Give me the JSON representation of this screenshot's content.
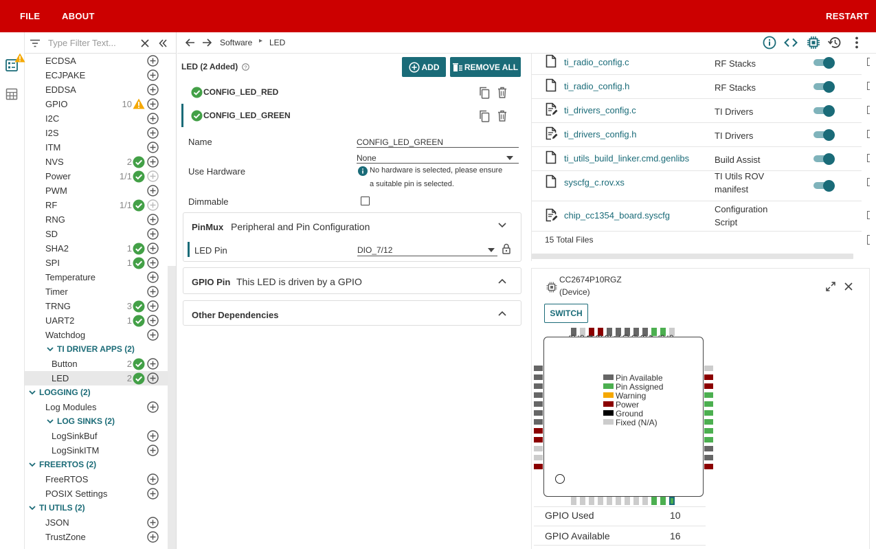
{
  "header": {
    "file": "FILE",
    "about": "ABOUT",
    "restart": "RESTART"
  },
  "filter": {
    "placeholder": "Type Filter Text..."
  },
  "tree": [
    {
      "label": "ECDSA",
      "indent": 1,
      "count": "",
      "status": "none"
    },
    {
      "label": "ECJPAKE",
      "indent": 1,
      "count": "",
      "status": "none"
    },
    {
      "label": "EDDSA",
      "indent": 1,
      "count": "",
      "status": "none"
    },
    {
      "label": "GPIO",
      "indent": 1,
      "count": "10",
      "status": "warn"
    },
    {
      "label": "I2C",
      "indent": 1,
      "count": "",
      "status": "none"
    },
    {
      "label": "I2S",
      "indent": 1,
      "count": "",
      "status": "none"
    },
    {
      "label": "ITM",
      "indent": 1,
      "count": "",
      "status": "none"
    },
    {
      "label": "NVS",
      "indent": 1,
      "count": "2",
      "status": "ok"
    },
    {
      "label": "Power",
      "indent": 1,
      "count": "1/1",
      "status": "ok",
      "disabled": true
    },
    {
      "label": "PWM",
      "indent": 1,
      "count": "",
      "status": "none"
    },
    {
      "label": "RF",
      "indent": 1,
      "count": "1/1",
      "status": "ok",
      "disabled": true
    },
    {
      "label": "RNG",
      "indent": 1,
      "count": "",
      "status": "none"
    },
    {
      "label": "SD",
      "indent": 1,
      "count": "",
      "status": "none"
    },
    {
      "label": "SHA2",
      "indent": 1,
      "count": "1",
      "status": "ok"
    },
    {
      "label": "SPI",
      "indent": 1,
      "count": "1",
      "status": "ok"
    },
    {
      "label": "Temperature",
      "indent": 1,
      "count": "",
      "status": "none"
    },
    {
      "label": "Timer",
      "indent": 1,
      "count": "",
      "status": "none"
    },
    {
      "label": "TRNG",
      "indent": 1,
      "count": "3",
      "status": "ok"
    },
    {
      "label": "UART2",
      "indent": 1,
      "count": "1",
      "status": "ok"
    },
    {
      "label": "Watchdog",
      "indent": 1,
      "count": "",
      "status": "none"
    },
    {
      "label": "TI DRIVER APPS (2)",
      "indent": 1,
      "group": true
    },
    {
      "label": "Button",
      "indent": 2,
      "count": "2",
      "status": "ok"
    },
    {
      "label": "LED",
      "indent": 2,
      "count": "2",
      "status": "ok",
      "selected": true
    },
    {
      "label": "LOGGING (2)",
      "indent": 0,
      "group": true
    },
    {
      "label": "Log Modules",
      "indent": 1,
      "count": "",
      "status": "none"
    },
    {
      "label": "LOG SINKS (2)",
      "indent": 1,
      "group": true
    },
    {
      "label": "LogSinkBuf",
      "indent": 2,
      "count": "",
      "status": "none"
    },
    {
      "label": "LogSinkITM",
      "indent": 2,
      "count": "",
      "status": "none"
    },
    {
      "label": "FREERTOS (2)",
      "indent": 0,
      "group": true
    },
    {
      "label": "FreeRTOS",
      "indent": 1,
      "count": "",
      "status": "none"
    },
    {
      "label": "POSIX Settings",
      "indent": 1,
      "count": "",
      "status": "none"
    },
    {
      "label": "TI UTILS (2)",
      "indent": 0,
      "group": true
    },
    {
      "label": "JSON",
      "indent": 1,
      "count": "",
      "status": "none"
    },
    {
      "label": "TrustZone",
      "indent": 1,
      "count": "",
      "status": "none"
    }
  ],
  "breadcrumb": {
    "root": "Software",
    "leaf": "LED"
  },
  "module": {
    "title": "LED (2 Added)",
    "add_label": "ADD",
    "remove_all_label": "REMOVE ALL",
    "instances": [
      "CONFIG_LED_RED",
      "CONFIG_LED_GREEN"
    ],
    "config": {
      "name_label": "Name",
      "name_value": "CONFIG_LED_GREEN",
      "hw_label": "Use Hardware",
      "hw_value": "None",
      "hw_info_line1": "No hardware is selected, please ensure",
      "hw_info_line2": "a suitable pin is selected.",
      "dimmable_label": "Dimmable"
    },
    "pinmux": {
      "title": "PinMux",
      "subtitle": "Peripheral and Pin Configuration",
      "pin_label": "LED Pin",
      "pin_value": "DIO_7/12"
    },
    "gpio_pin": {
      "title": "GPIO Pin",
      "subtitle": "This LED is driven by a GPIO"
    },
    "other_deps": {
      "title": "Other Dependencies"
    }
  },
  "files": {
    "rows": [
      {
        "name": "ti_radio_config.c",
        "category": "RF Stacks",
        "icon": "file-icon",
        "toggle": true
      },
      {
        "name": "ti_radio_config.h",
        "category": "RF Stacks",
        "icon": "file-icon",
        "toggle": true
      },
      {
        "name": "ti_drivers_config.c",
        "category": "TI Drivers",
        "icon": "file-edit-icon",
        "toggle": true
      },
      {
        "name": "ti_drivers_config.h",
        "category": "TI Drivers",
        "icon": "file-edit-icon",
        "toggle": true
      },
      {
        "name": "ti_utils_build_linker.cmd.genlibs",
        "category": "Build Assist",
        "icon": "file-icon",
        "toggle": true
      },
      {
        "name": "syscfg_c.rov.xs",
        "category": "TI Utils ROV manifest",
        "icon": "file-icon",
        "toggle": true
      },
      {
        "name": "chip_cc1354_board.syscfg",
        "category": "Configuration Script",
        "icon": "file-edit-icon",
        "toggle": false
      }
    ],
    "total": "15 Total Files"
  },
  "device": {
    "name": "CC2674P10RGZ",
    "sub": "(Device)",
    "switch_label": "SWITCH",
    "legend": [
      "Pin Available",
      "Pin Assigned",
      "Warning",
      "Power",
      "Ground",
      "Fixed (N/A)"
    ],
    "colors": {
      "available": "#666666",
      "assigned": "#4caf50",
      "warning": "#f5a800",
      "power": "#8b0000",
      "ground": "#000000",
      "fixed": "#cccccc"
    },
    "top_pins": [
      "36",
      "35",
      "34",
      "33",
      "32",
      "31",
      "30",
      "29",
      "28",
      "27",
      "26",
      "25"
    ],
    "top_types": [
      "available",
      "fixed",
      "power",
      "power",
      "available",
      "available",
      "available",
      "available",
      "available",
      "assigned",
      "assigned",
      "fixed"
    ],
    "left_pins": [
      "37",
      "38",
      "39",
      "40",
      "41",
      "42",
      "43",
      "44",
      "45",
      "46",
      "47",
      "48"
    ],
    "left_types": [
      "available",
      "available",
      "available",
      "available",
      "available",
      "available",
      "available",
      "power",
      "power",
      "fixed",
      "fixed",
      "power"
    ],
    "right_pins": [
      "24",
      "23",
      "22",
      "21",
      "20",
      "19",
      "18",
      "17",
      "16",
      "15",
      "14",
      "13"
    ],
    "right_types": [
      "fixed",
      "power",
      "power",
      "assigned",
      "assigned",
      "assigned",
      "assigned",
      "assigned",
      "assigned",
      "available",
      "available",
      "power"
    ],
    "bottom_pins": [
      "1",
      "2",
      "3",
      "4",
      "5",
      "6",
      "7",
      "8",
      "9",
      "10",
      "11",
      "12"
    ],
    "bottom_types": [
      "fixed",
      "fixed",
      "fixed",
      "fixed",
      "fixed",
      "fixed",
      "fixed",
      "fixed",
      "fixed",
      "assigned",
      "assigned",
      "assigned-sel"
    ],
    "gpio_used_label": "GPIO Used",
    "gpio_used": "10",
    "gpio_avail_label": "GPIO Available",
    "gpio_avail": "16"
  }
}
